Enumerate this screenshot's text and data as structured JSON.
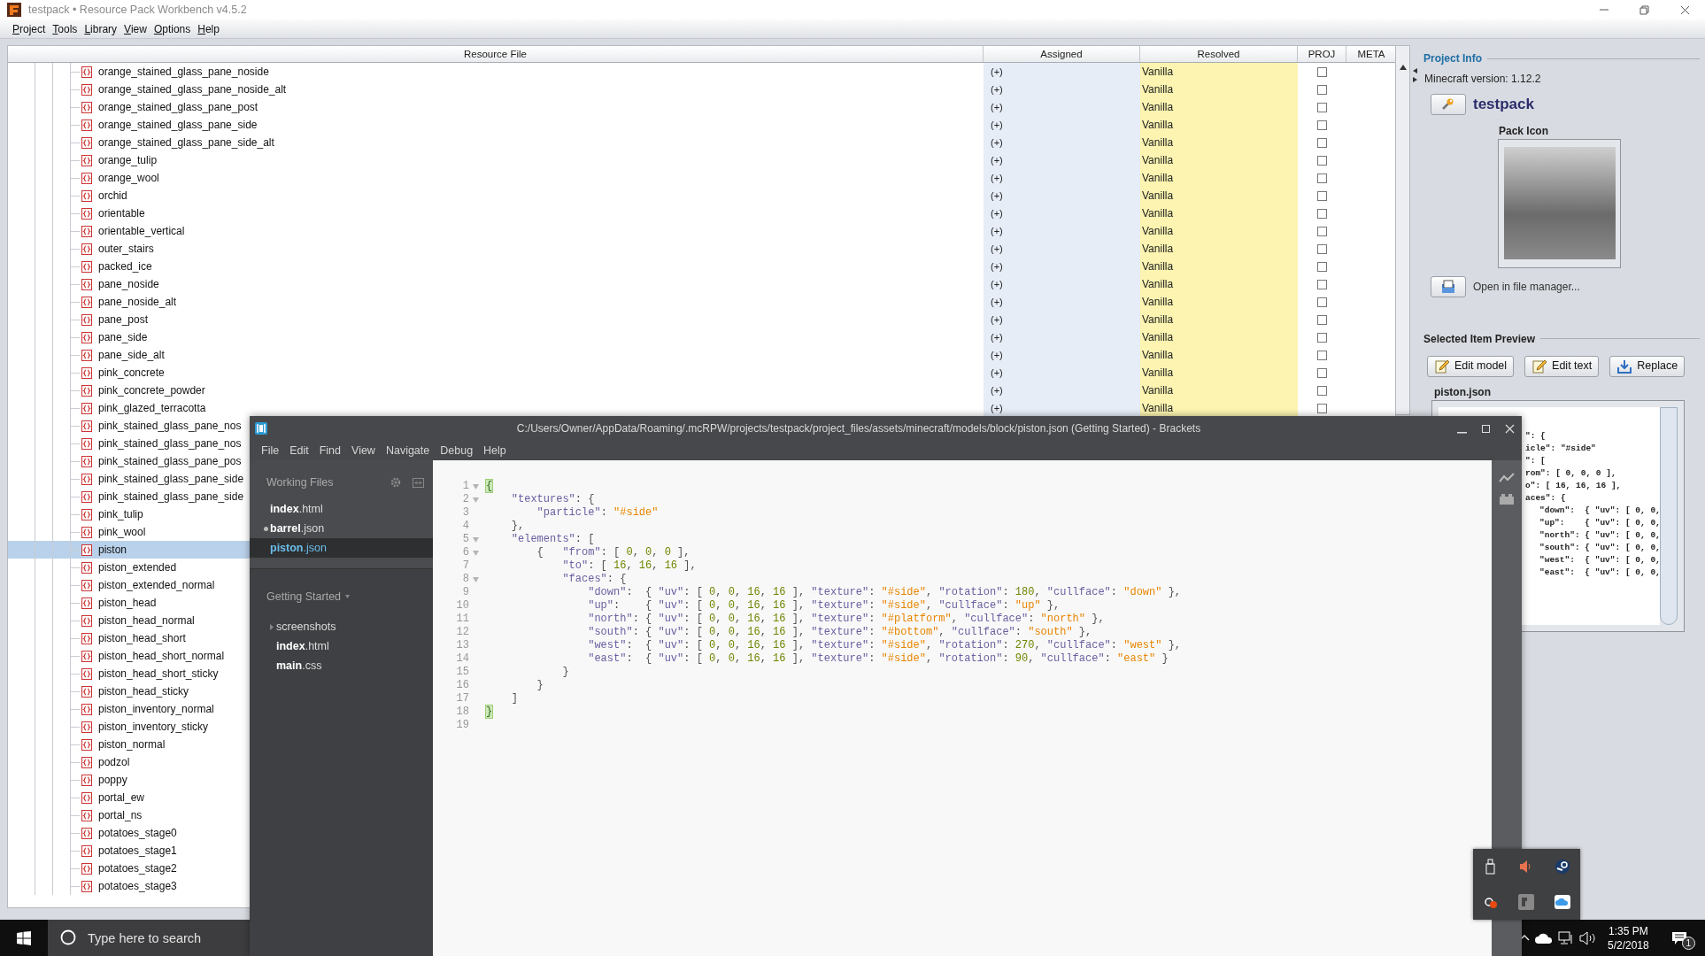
{
  "main_window": {
    "title": "testpack • Resource Pack Workbench v4.5.2",
    "menu": [
      "Project",
      "Tools",
      "Library",
      "View",
      "Options",
      "Help"
    ]
  },
  "resource_table": {
    "columns": [
      "Resource File",
      "Assigned",
      "Resolved",
      "PROJ",
      "META"
    ],
    "rows": [
      {
        "name": "orange_stained_glass_pane_noside",
        "assigned": "(+)",
        "resolved": "Vanilla",
        "proj_checked": false,
        "selected": false
      },
      {
        "name": "orange_stained_glass_pane_noside_alt",
        "assigned": "(+)",
        "resolved": "Vanilla",
        "proj_checked": false,
        "selected": false
      },
      {
        "name": "orange_stained_glass_pane_post",
        "assigned": "(+)",
        "resolved": "Vanilla",
        "proj_checked": false,
        "selected": false
      },
      {
        "name": "orange_stained_glass_pane_side",
        "assigned": "(+)",
        "resolved": "Vanilla",
        "proj_checked": false,
        "selected": false
      },
      {
        "name": "orange_stained_glass_pane_side_alt",
        "assigned": "(+)",
        "resolved": "Vanilla",
        "proj_checked": false,
        "selected": false
      },
      {
        "name": "orange_tulip",
        "assigned": "(+)",
        "resolved": "Vanilla",
        "proj_checked": false,
        "selected": false
      },
      {
        "name": "orange_wool",
        "assigned": "(+)",
        "resolved": "Vanilla",
        "proj_checked": false,
        "selected": false
      },
      {
        "name": "orchid",
        "assigned": "(+)",
        "resolved": "Vanilla",
        "proj_checked": false,
        "selected": false
      },
      {
        "name": "orientable",
        "assigned": "(+)",
        "resolved": "Vanilla",
        "proj_checked": false,
        "selected": false
      },
      {
        "name": "orientable_vertical",
        "assigned": "(+)",
        "resolved": "Vanilla",
        "proj_checked": false,
        "selected": false
      },
      {
        "name": "outer_stairs",
        "assigned": "(+)",
        "resolved": "Vanilla",
        "proj_checked": false,
        "selected": false
      },
      {
        "name": "packed_ice",
        "assigned": "(+)",
        "resolved": "Vanilla",
        "proj_checked": false,
        "selected": false
      },
      {
        "name": "pane_noside",
        "assigned": "(+)",
        "resolved": "Vanilla",
        "proj_checked": false,
        "selected": false
      },
      {
        "name": "pane_noside_alt",
        "assigned": "(+)",
        "resolved": "Vanilla",
        "proj_checked": false,
        "selected": false
      },
      {
        "name": "pane_post",
        "assigned": "(+)",
        "resolved": "Vanilla",
        "proj_checked": false,
        "selected": false
      },
      {
        "name": "pane_side",
        "assigned": "(+)",
        "resolved": "Vanilla",
        "proj_checked": false,
        "selected": false
      },
      {
        "name": "pane_side_alt",
        "assigned": "(+)",
        "resolved": "Vanilla",
        "proj_checked": false,
        "selected": false
      },
      {
        "name": "pink_concrete",
        "assigned": "(+)",
        "resolved": "Vanilla",
        "proj_checked": false,
        "selected": false
      },
      {
        "name": "pink_concrete_powder",
        "assigned": "(+)",
        "resolved": "Vanilla",
        "proj_checked": false,
        "selected": false
      },
      {
        "name": "pink_glazed_terracotta",
        "assigned": "(+)",
        "resolved": "Vanilla",
        "proj_checked": false,
        "selected": false
      },
      {
        "name": "pink_stained_glass_pane_nos",
        "selected": false
      },
      {
        "name": "pink_stained_glass_pane_nos",
        "selected": false
      },
      {
        "name": "pink_stained_glass_pane_pos",
        "selected": false
      },
      {
        "name": "pink_stained_glass_pane_side",
        "selected": false
      },
      {
        "name": "pink_stained_glass_pane_side",
        "selected": false
      },
      {
        "name": "pink_tulip",
        "selected": false
      },
      {
        "name": "pink_wool",
        "selected": false
      },
      {
        "name": "piston",
        "selected": true
      },
      {
        "name": "piston_extended",
        "selected": false
      },
      {
        "name": "piston_extended_normal",
        "selected": false
      },
      {
        "name": "piston_head",
        "selected": false
      },
      {
        "name": "piston_head_normal",
        "selected": false
      },
      {
        "name": "piston_head_short",
        "selected": false
      },
      {
        "name": "piston_head_short_normal",
        "selected": false
      },
      {
        "name": "piston_head_short_sticky",
        "selected": false
      },
      {
        "name": "piston_head_sticky",
        "selected": false
      },
      {
        "name": "piston_inventory_normal",
        "selected": false
      },
      {
        "name": "piston_inventory_sticky",
        "selected": false
      },
      {
        "name": "piston_normal",
        "selected": false
      },
      {
        "name": "podzol",
        "selected": false
      },
      {
        "name": "poppy",
        "selected": false
      },
      {
        "name": "portal_ew",
        "selected": false
      },
      {
        "name": "portal_ns",
        "selected": false
      },
      {
        "name": "potatoes_stage0",
        "selected": false
      },
      {
        "name": "potatoes_stage1",
        "selected": false
      },
      {
        "name": "potatoes_stage2",
        "selected": false
      },
      {
        "name": "potatoes_stage3",
        "selected": false
      }
    ]
  },
  "project_info": {
    "header": "Project Info",
    "minecraft_version": "Minecraft version: 1.12.2",
    "pack_name": "testpack",
    "pack_icon_label": "Pack Icon",
    "open_button": "Open in file manager..."
  },
  "item_preview": {
    "header": "Selected Item Preview",
    "buttons": [
      {
        "kind": "edit-model",
        "label": "Edit model"
      },
      {
        "kind": "edit-text",
        "label": "Edit text"
      },
      {
        "kind": "replace",
        "label": "Replace"
      }
    ],
    "file_name": "piston.json",
    "lines": [
      {
        "text": "\": {",
        "nested": false
      },
      {
        "text": "icle\": \"#side\"",
        "nested": false
      },
      {
        "text": "\": [",
        "nested": false
      },
      {
        "text": "rom\": [ 0, 0, 0 ],",
        "nested": false
      },
      {
        "text": "o\": [ 16, 16, 16 ],",
        "nested": false
      },
      {
        "text": "aces\": {",
        "nested": false
      },
      {
        "text": "\"down\":  { \"uv\": [ 0, 0,",
        "nested": true
      },
      {
        "text": "\"up\":    { \"uv\": [ 0, 0,",
        "nested": true
      },
      {
        "text": "\"north\": { \"uv\": [ 0, 0,",
        "nested": true
      },
      {
        "text": "\"south\": { \"uv\": [ 0, 0,",
        "nested": true
      },
      {
        "text": "\"west\":  { \"uv\": [ 0, 0,",
        "nested": true
      },
      {
        "text": "\"east\":  { \"uv\": [ 0, 0,",
        "nested": true
      }
    ]
  },
  "editor_window": {
    "title": "C:/Users/Owner/AppData/Roaming/.mcRPW/projects/testpack/project_files/assets/minecraft/models/block/piston.json (Getting Started) - Brackets",
    "menu": [
      "File",
      "Edit",
      "Find",
      "View",
      "Navigate",
      "Debug",
      "Help"
    ],
    "working_files": {
      "header": "Working Files",
      "files": [
        {
          "name": "**index**.html",
          "modified": false,
          "selected": false
        },
        {
          "name": "**barrel**.json",
          "modified": true,
          "selected": false
        },
        {
          "name": "**piston**.json",
          "modified": false,
          "selected": true
        }
      ]
    },
    "project": {
      "header": "Getting Started",
      "items": [
        {
          "kind": "folder",
          "name": "screenshots"
        },
        {
          "kind": "file",
          "name": "**index**.html"
        },
        {
          "kind": "file",
          "name": "**main**.css"
        }
      ]
    },
    "code_lines": [
      {
        "number": "1",
        "fold": true,
        "tokens": [
          {
            "kind": "brace",
            "text": "{"
          }
        ]
      },
      {
        "number": "2",
        "fold": true,
        "tokens": [
          {
            "kind": "key",
            "text": "    \"textures\""
          },
          {
            "kind": "punct",
            "text": ": {"
          }
        ]
      },
      {
        "number": "3",
        "fold": false,
        "tokens": [
          {
            "kind": "key",
            "text": "        \"particle\""
          },
          {
            "kind": "punct",
            "text": ": "
          },
          {
            "kind": "string",
            "text": "\"#side\""
          }
        ]
      },
      {
        "number": "4",
        "fold": false,
        "tokens": [
          {
            "kind": "punct",
            "text": "    },"
          }
        ]
      },
      {
        "number": "5",
        "fold": true,
        "tokens": [
          {
            "kind": "key",
            "text": "    \"elements\""
          },
          {
            "kind": "punct",
            "text": ": ["
          }
        ]
      },
      {
        "number": "6",
        "fold": true,
        "tokens": [
          {
            "kind": "punct",
            "text": "        {   "
          },
          {
            "kind": "key",
            "text": "\"from\""
          },
          {
            "kind": "punct",
            "text": ": [ "
          },
          {
            "kind": "number",
            "text": "0"
          },
          {
            "kind": "punct",
            "text": ", "
          },
          {
            "kind": "number",
            "text": "0"
          },
          {
            "kind": "punct",
            "text": ", "
          },
          {
            "kind": "number",
            "text": "0"
          },
          {
            "kind": "punct",
            "text": " ],"
          }
        ]
      },
      {
        "number": "7",
        "fold": false,
        "tokens": [
          {
            "kind": "key",
            "text": "            \"to\""
          },
          {
            "kind": "punct",
            "text": ": [ "
          },
          {
            "kind": "number",
            "text": "16"
          },
          {
            "kind": "punct",
            "text": ", "
          },
          {
            "kind": "number",
            "text": "16"
          },
          {
            "kind": "punct",
            "text": ", "
          },
          {
            "kind": "number",
            "text": "16"
          },
          {
            "kind": "punct",
            "text": " ],"
          }
        ]
      },
      {
        "number": "8",
        "fold": true,
        "tokens": [
          {
            "kind": "key",
            "text": "            \"faces\""
          },
          {
            "kind": "punct",
            "text": ": {"
          }
        ]
      },
      {
        "number": "9",
        "fold": false,
        "tokens": [
          {
            "kind": "key",
            "text": "                \"down\""
          },
          {
            "kind": "punct",
            "text": ":  { "
          },
          {
            "kind": "key",
            "text": "\"uv\""
          },
          {
            "kind": "punct",
            "text": ": [ "
          },
          {
            "kind": "number",
            "text": "0"
          },
          {
            "kind": "punct",
            "text": ", "
          },
          {
            "kind": "number",
            "text": "0"
          },
          {
            "kind": "punct",
            "text": ", "
          },
          {
            "kind": "number",
            "text": "16"
          },
          {
            "kind": "punct",
            "text": ", "
          },
          {
            "kind": "number",
            "text": "16"
          },
          {
            "kind": "punct",
            "text": " ], "
          },
          {
            "kind": "key",
            "text": "\"texture\""
          },
          {
            "kind": "punct",
            "text": ": "
          },
          {
            "kind": "string",
            "text": "\"#side\""
          },
          {
            "kind": "punct",
            "text": ", "
          },
          {
            "kind": "key",
            "text": "\"rotation\""
          },
          {
            "kind": "punct",
            "text": ": "
          },
          {
            "kind": "number",
            "text": "180"
          },
          {
            "kind": "punct",
            "text": ", "
          },
          {
            "kind": "key",
            "text": "\"cullface\""
          },
          {
            "kind": "punct",
            "text": ": "
          },
          {
            "kind": "string",
            "text": "\"down\""
          },
          {
            "kind": "punct",
            "text": " },"
          }
        ]
      },
      {
        "number": "10",
        "fold": false,
        "tokens": [
          {
            "kind": "key",
            "text": "                \"up\""
          },
          {
            "kind": "punct",
            "text": ":    { "
          },
          {
            "kind": "key",
            "text": "\"uv\""
          },
          {
            "kind": "punct",
            "text": ": [ "
          },
          {
            "kind": "number",
            "text": "0"
          },
          {
            "kind": "punct",
            "text": ", "
          },
          {
            "kind": "number",
            "text": "0"
          },
          {
            "kind": "punct",
            "text": ", "
          },
          {
            "kind": "number",
            "text": "16"
          },
          {
            "kind": "punct",
            "text": ", "
          },
          {
            "kind": "number",
            "text": "16"
          },
          {
            "kind": "punct",
            "text": " ], "
          },
          {
            "kind": "key",
            "text": "\"texture\""
          },
          {
            "kind": "punct",
            "text": ": "
          },
          {
            "kind": "string",
            "text": "\"#side\""
          },
          {
            "kind": "punct",
            "text": ", "
          },
          {
            "kind": "key",
            "text": "\"cullface\""
          },
          {
            "kind": "punct",
            "text": ": "
          },
          {
            "kind": "string",
            "text": "\"up\""
          },
          {
            "kind": "punct",
            "text": " },"
          }
        ]
      },
      {
        "number": "11",
        "fold": false,
        "tokens": [
          {
            "kind": "key",
            "text": "                \"north\""
          },
          {
            "kind": "punct",
            "text": ": { "
          },
          {
            "kind": "key",
            "text": "\"uv\""
          },
          {
            "kind": "punct",
            "text": ": [ "
          },
          {
            "kind": "number",
            "text": "0"
          },
          {
            "kind": "punct",
            "text": ", "
          },
          {
            "kind": "number",
            "text": "0"
          },
          {
            "kind": "punct",
            "text": ", "
          },
          {
            "kind": "number",
            "text": "16"
          },
          {
            "kind": "punct",
            "text": ", "
          },
          {
            "kind": "number",
            "text": "16"
          },
          {
            "kind": "punct",
            "text": " ], "
          },
          {
            "kind": "key",
            "text": "\"texture\""
          },
          {
            "kind": "punct",
            "text": ": "
          },
          {
            "kind": "string",
            "text": "\"#platform\""
          },
          {
            "kind": "punct",
            "text": ", "
          },
          {
            "kind": "key",
            "text": "\"cullface\""
          },
          {
            "kind": "punct",
            "text": ": "
          },
          {
            "kind": "string",
            "text": "\"north\""
          },
          {
            "kind": "punct",
            "text": " },"
          }
        ]
      },
      {
        "number": "12",
        "fold": false,
        "tokens": [
          {
            "kind": "key",
            "text": "                \"south\""
          },
          {
            "kind": "punct",
            "text": ": { "
          },
          {
            "kind": "key",
            "text": "\"uv\""
          },
          {
            "kind": "punct",
            "text": ": [ "
          },
          {
            "kind": "number",
            "text": "0"
          },
          {
            "kind": "punct",
            "text": ", "
          },
          {
            "kind": "number",
            "text": "0"
          },
          {
            "kind": "punct",
            "text": ", "
          },
          {
            "kind": "number",
            "text": "16"
          },
          {
            "kind": "punct",
            "text": ", "
          },
          {
            "kind": "number",
            "text": "16"
          },
          {
            "kind": "punct",
            "text": " ], "
          },
          {
            "kind": "key",
            "text": "\"texture\""
          },
          {
            "kind": "punct",
            "text": ": "
          },
          {
            "kind": "string",
            "text": "\"#bottom\""
          },
          {
            "kind": "punct",
            "text": ", "
          },
          {
            "kind": "key",
            "text": "\"cullface\""
          },
          {
            "kind": "punct",
            "text": ": "
          },
          {
            "kind": "string",
            "text": "\"south\""
          },
          {
            "kind": "punct",
            "text": " },"
          }
        ]
      },
      {
        "number": "13",
        "fold": false,
        "tokens": [
          {
            "kind": "key",
            "text": "                \"west\""
          },
          {
            "kind": "punct",
            "text": ":  { "
          },
          {
            "kind": "key",
            "text": "\"uv\""
          },
          {
            "kind": "punct",
            "text": ": [ "
          },
          {
            "kind": "number",
            "text": "0"
          },
          {
            "kind": "punct",
            "text": ", "
          },
          {
            "kind": "number",
            "text": "0"
          },
          {
            "kind": "punct",
            "text": ", "
          },
          {
            "kind": "number",
            "text": "16"
          },
          {
            "kind": "punct",
            "text": ", "
          },
          {
            "kind": "number",
            "text": "16"
          },
          {
            "kind": "punct",
            "text": " ], "
          },
          {
            "kind": "key",
            "text": "\"texture\""
          },
          {
            "kind": "punct",
            "text": ": "
          },
          {
            "kind": "string",
            "text": "\"#side\""
          },
          {
            "kind": "punct",
            "text": ", "
          },
          {
            "kind": "key",
            "text": "\"rotation\""
          },
          {
            "kind": "punct",
            "text": ": "
          },
          {
            "kind": "number",
            "text": "270"
          },
          {
            "kind": "punct",
            "text": ", "
          },
          {
            "kind": "key",
            "text": "\"cullface\""
          },
          {
            "kind": "punct",
            "text": ": "
          },
          {
            "kind": "string",
            "text": "\"west\""
          },
          {
            "kind": "punct",
            "text": " },"
          }
        ]
      },
      {
        "number": "14",
        "fold": false,
        "tokens": [
          {
            "kind": "key",
            "text": "                \"east\""
          },
          {
            "kind": "punct",
            "text": ":  { "
          },
          {
            "kind": "key",
            "text": "\"uv\""
          },
          {
            "kind": "punct",
            "text": ": [ "
          },
          {
            "kind": "number",
            "text": "0"
          },
          {
            "kind": "punct",
            "text": ", "
          },
          {
            "kind": "number",
            "text": "0"
          },
          {
            "kind": "punct",
            "text": ", "
          },
          {
            "kind": "number",
            "text": "16"
          },
          {
            "kind": "punct",
            "text": ", "
          },
          {
            "kind": "number",
            "text": "16"
          },
          {
            "kind": "punct",
            "text": " ], "
          },
          {
            "kind": "key",
            "text": "\"texture\""
          },
          {
            "kind": "punct",
            "text": ": "
          },
          {
            "kind": "string",
            "text": "\"#side\""
          },
          {
            "kind": "punct",
            "text": ", "
          },
          {
            "kind": "key",
            "text": "\"rotation\""
          },
          {
            "kind": "punct",
            "text": ": "
          },
          {
            "kind": "number",
            "text": "90"
          },
          {
            "kind": "punct",
            "text": ", "
          },
          {
            "kind": "key",
            "text": "\"cullface\""
          },
          {
            "kind": "punct",
            "text": ": "
          },
          {
            "kind": "string",
            "text": "\"east\""
          },
          {
            "kind": "punct",
            "text": " }"
          }
        ]
      },
      {
        "number": "15",
        "fold": false,
        "tokens": [
          {
            "kind": "punct",
            "text": "            }"
          }
        ]
      },
      {
        "number": "16",
        "fold": false,
        "tokens": [
          {
            "kind": "punct",
            "text": "        }"
          }
        ]
      },
      {
        "number": "17",
        "fold": false,
        "tokens": [
          {
            "kind": "punct",
            "text": "    ]"
          }
        ]
      },
      {
        "number": "18",
        "fold": false,
        "tokens": [
          {
            "kind": "brace",
            "text": "}"
          }
        ]
      },
      {
        "number": "19",
        "fold": false
      }
    ]
  },
  "taskbar": {
    "search_placeholder": "Type here to search",
    "time": "1:35 PM",
    "date": "5/2/2018",
    "notification_count": "1"
  }
}
